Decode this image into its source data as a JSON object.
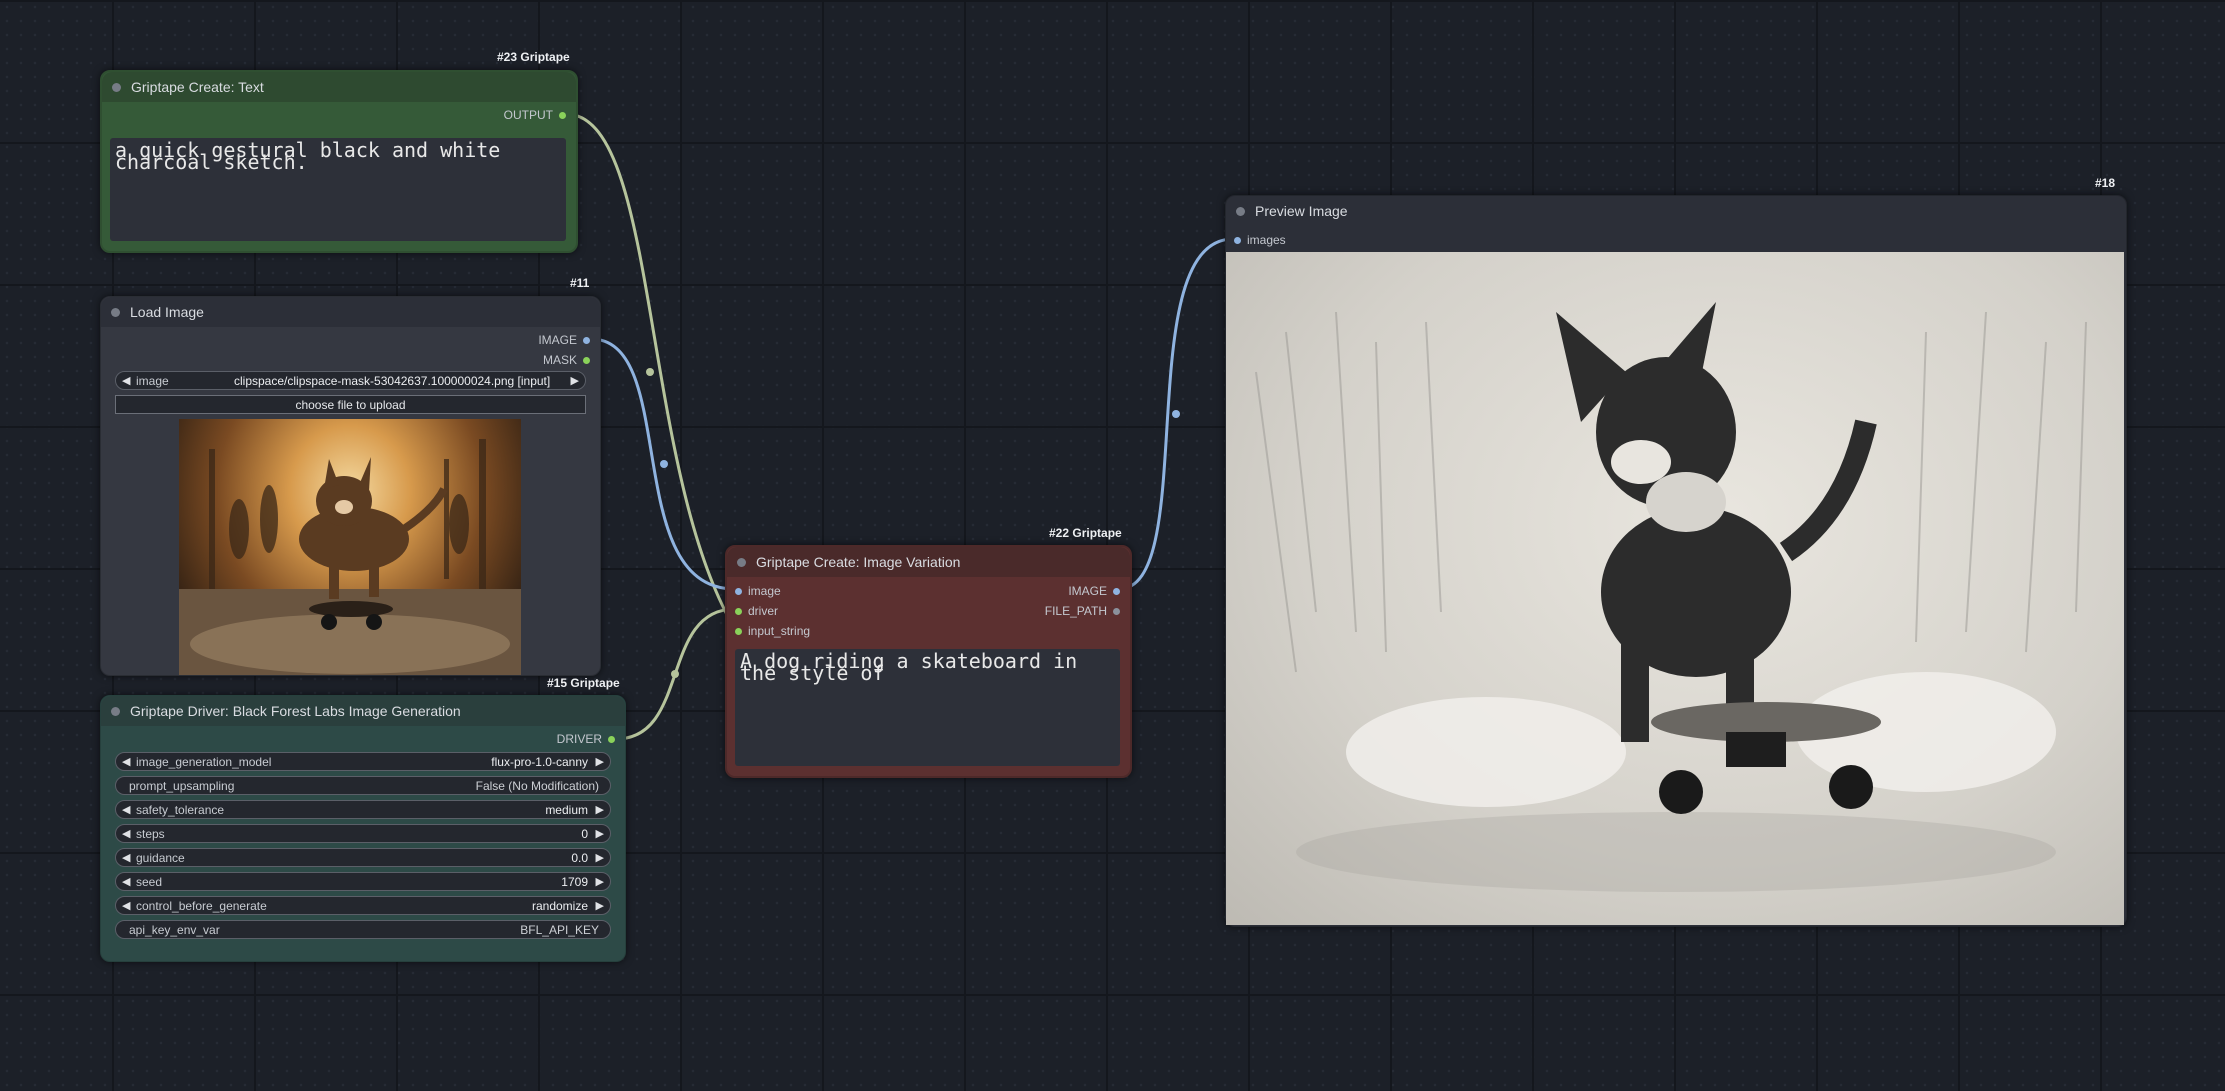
{
  "nodes": {
    "text": {
      "title": "Griptape Create: Text",
      "badge": "#23 Griptape",
      "output": "OUTPUT",
      "text": "a quick gestural black and white\ncharcoal sketch."
    },
    "load_image": {
      "title": "Load Image",
      "badge": "#11",
      "outputs": [
        "IMAGE",
        "MASK"
      ],
      "image_label": "image",
      "image_value": "clipspace/clipspace-mask-53042637.100000024.png [input]",
      "upload_label": "choose file to upload",
      "preview_alt": "photo of a small dog riding a skateboard"
    },
    "driver": {
      "title": "Griptape Driver: Black Forest Labs Image Generation",
      "badge": "#15 Griptape",
      "output": "DRIVER",
      "widgets": [
        {
          "label": "image_generation_model",
          "value": "flux-pro-1.0-canny",
          "arrows": true
        },
        {
          "label": "prompt_upsampling",
          "value": "False (No Modification)",
          "arrows": false
        },
        {
          "label": "safety_tolerance",
          "value": "medium",
          "arrows": true
        },
        {
          "label": "steps",
          "value": "0",
          "arrows": true
        },
        {
          "label": "guidance",
          "value": "0.0",
          "arrows": true
        },
        {
          "label": "seed",
          "value": "1709",
          "arrows": true
        },
        {
          "label": "control_before_generate",
          "value": "randomize",
          "arrows": true
        },
        {
          "label": "api_key_env_var",
          "value": "BFL_API_KEY",
          "arrows": false
        }
      ]
    },
    "variation": {
      "title": "Griptape Create: Image Variation",
      "badge": "#22 Griptape",
      "inputs": [
        "image",
        "driver",
        "input_string"
      ],
      "outputs": [
        "IMAGE",
        "FILE_PATH"
      ],
      "text": "A dog riding a skateboard in\nthe style of"
    },
    "preview": {
      "title": "Preview Image",
      "badge": "#18",
      "input": "images",
      "image_alt": "charcoal sketch of a dog on a skateboard"
    }
  },
  "colors": {
    "canvas": "#1c2028",
    "green_node": "#355a38",
    "red_node": "#5c3030",
    "teal_node": "#2d4a47",
    "grey_node": "#2c2f38",
    "link_text": "#b6c49c",
    "link_image": "#8fb3e0"
  }
}
